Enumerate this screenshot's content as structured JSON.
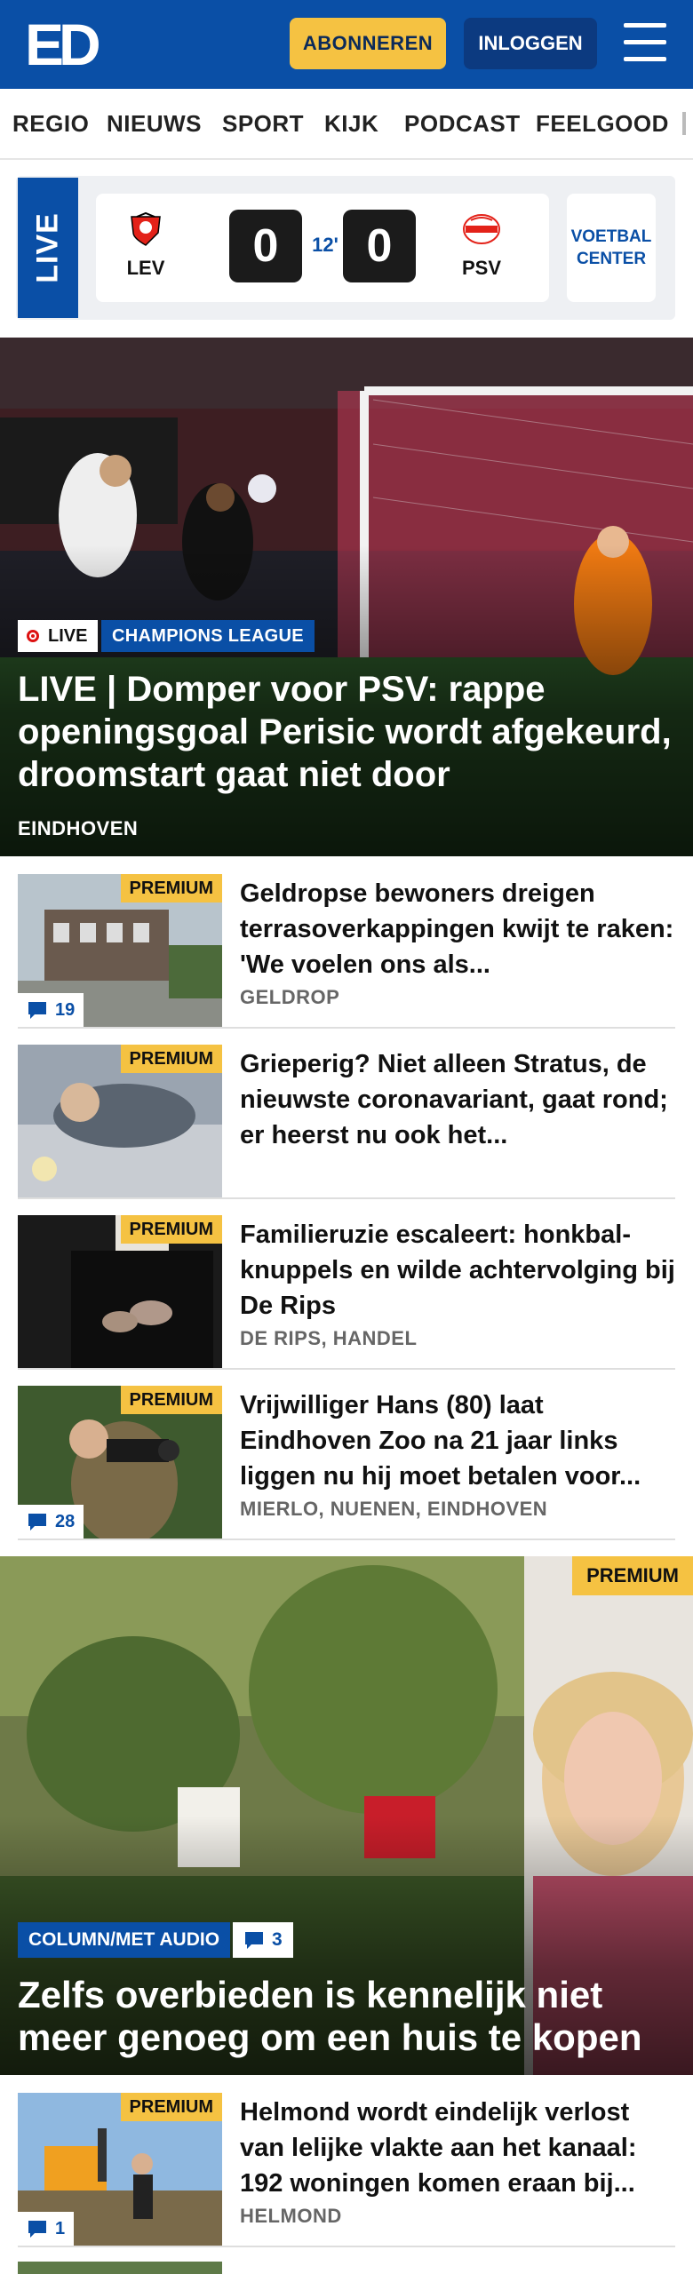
{
  "header": {
    "logo": "ED",
    "subscribe_label": "ABONNEREN",
    "login_label": "INLOGGEN"
  },
  "nav": {
    "items": [
      "REGIO",
      "NIEUWS",
      "SPORT",
      "KIJK",
      "PODCAST",
      "FEELGOOD"
    ]
  },
  "live": {
    "tab_label": "LIVE",
    "home_team": "LEV",
    "away_team": "PSV",
    "home_score": "0",
    "away_score": "0",
    "minute": "12'",
    "voetbal_center_line1": "VOETBAL",
    "voetbal_center_line2": "CENTER"
  },
  "hero": {
    "live_badge": "LIVE",
    "category": "CHAMPIONS LEAGUE",
    "title": "LIVE | Domper voor PSV: rappe openingsgoal Perisic wordt afgekeurd, droomstart gaat niet door",
    "location": "EINDHOVEN"
  },
  "articles": [
    {
      "premium": "PREMIUM",
      "comments": "19",
      "title": "Geldropse bewoners dreigen terrasoverkappingen kwijt te raken: 'We voelen ons als...",
      "location": "GELDROP"
    },
    {
      "premium": "PREMIUM",
      "comments": "",
      "title": "Grieperig? Niet alleen Stratus, de nieuwste coronavariant, gaat rond; er heerst nu ook het...",
      "location": ""
    },
    {
      "premium": "PREMIUM",
      "comments": "",
      "title": "Familieruzie escaleert: honkbal-knuppels en wilde achtervolging bij De Rips",
      "location": "DE RIPS, HANDEL"
    },
    {
      "premium": "PREMIUM",
      "comments": "28",
      "title": "Vrijwilliger Hans (80) laat Eindhoven Zoo na 21 jaar links liggen nu hij moet betalen voor...",
      "location": "MIERLO, NUENEN, EINDHOVEN"
    }
  ],
  "feature": {
    "premium": "PREMIUM",
    "category": "COLUMN/MET AUDIO",
    "comments": "3",
    "title": "Zelfs overbieden is kennelijk niet meer genoeg om een huis te kopen"
  },
  "article_after": {
    "premium": "PREMIUM",
    "comments": "1",
    "title": "Helmond wordt eindelijk verlost van lelijke vlakte aan het kanaal: 192 woningen komen eraan bij...",
    "location": "HELMOND"
  },
  "colors": {
    "brand_blue": "#0a4fa6",
    "premium_yellow": "#f5c242",
    "dark_blue": "#0c3a80"
  },
  "icons": [
    "hamburger-menu-icon",
    "comment-icon",
    "live-dot-icon",
    "bayer-leverkusen-crest",
    "psv-crest"
  ]
}
